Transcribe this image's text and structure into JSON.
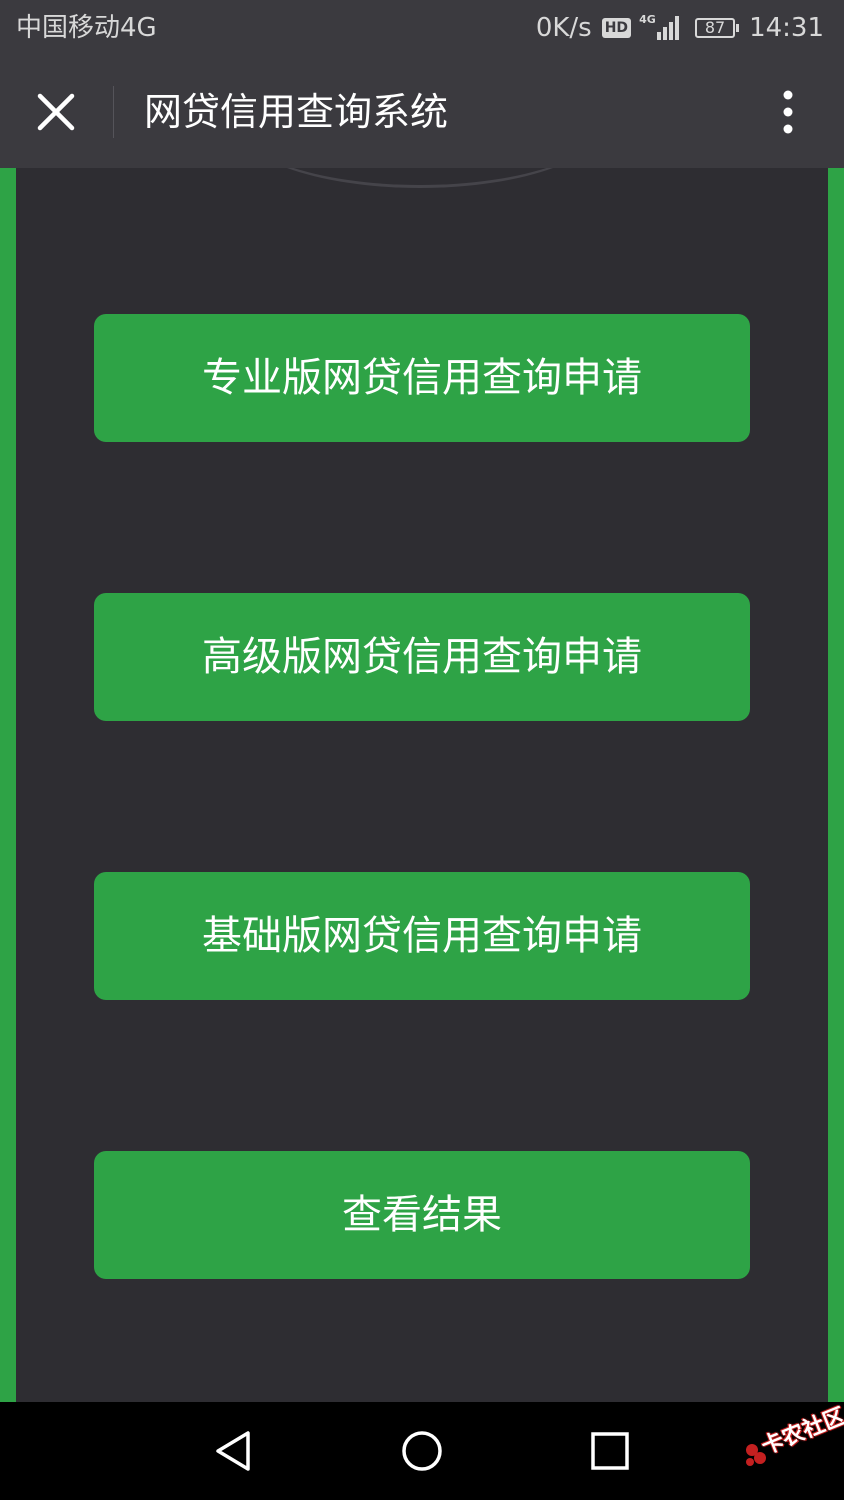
{
  "status_bar": {
    "carrier": "中国移动4G",
    "net_speed": "0K/s",
    "hd_badge": "HD",
    "network_type": "4G",
    "battery": "87",
    "time": "14:31"
  },
  "title_bar": {
    "title": "网贷信用查询系统",
    "close_icon": "close-icon",
    "menu_icon": "more-vertical-icon"
  },
  "menu": {
    "buttons": [
      {
        "label": "专业版网贷信用查询申请"
      },
      {
        "label": "高级版网贷信用查询申请"
      },
      {
        "label": "基础版网贷信用查询申请"
      },
      {
        "label": "查看结果"
      }
    ]
  },
  "nav_bar": {
    "back_icon": "back-triangle-icon",
    "home_icon": "home-circle-icon",
    "recents_icon": "recents-square-icon"
  },
  "watermark": {
    "text": "卡农社区"
  },
  "colors": {
    "accent": "#2ea346",
    "bar_background": "#3b3a3f",
    "page_background": "#2e2d32",
    "nav_background": "#000000"
  }
}
